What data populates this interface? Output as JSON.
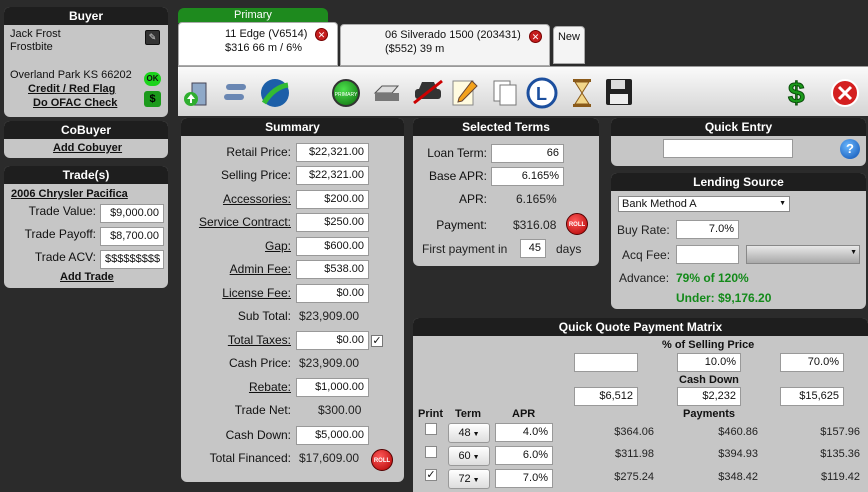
{
  "buyer": {
    "title": "Buyer",
    "name_first": "Jack Frost",
    "name_last": "Frostbite",
    "location": "Overland Park KS 66202",
    "credit_link": "Credit / Red Flag",
    "ofac_link": "Do OFAC Check",
    "ok_badge": "OK",
    "dollar_badge": "$"
  },
  "cobuyer": {
    "title": "CoBuyer",
    "add_link": "Add Cobuyer"
  },
  "trades": {
    "title": "Trade(s)",
    "vehicle": "2006 Chrysler Pacifica",
    "trade_value_label": "Trade Value:",
    "trade_value": "$9,000.00",
    "trade_payoff_label": "Trade Payoff:",
    "trade_payoff": "$8,700.00",
    "trade_acv_label": "Trade ACV:",
    "trade_acv": "$$$$$$$$$",
    "add_link": "Add Trade"
  },
  "tabs": {
    "primary_label": "Primary",
    "tab1_line1": "11 Edge  (V6514)",
    "tab1_line2": "$316 66 m / 6%",
    "tab2_line1": "06 Silverado 1500  (203431)",
    "tab2_line2": "($552) 39 m",
    "new_label": "New"
  },
  "toolbar": {
    "primary_badge": "PRIMARY"
  },
  "summary": {
    "title": "Summary",
    "retail_label": "Retail Price:",
    "retail": "$22,321.00",
    "selling_label": "Selling Price:",
    "selling": "$22,321.00",
    "accessories_label": "Accessories:",
    "accessories": "$200.00",
    "service_label": "Service Contract:",
    "service": "$250.00",
    "gap_label": "Gap:",
    "gap": "$600.00",
    "admin_label": "Admin Fee:",
    "admin": "$538.00",
    "license_label": "License Fee:",
    "license": "$0.00",
    "subtotal_label": "Sub Total:",
    "subtotal": "$23,909.00",
    "taxes_label": "Total Taxes:",
    "taxes": "$0.00",
    "cash_price_label": "Cash Price:",
    "cash_price": "$23,909.00",
    "rebate_label": "Rebate:",
    "rebate": "$1,000.00",
    "trade_net_label": "Trade Net:",
    "trade_net": "$300.00",
    "cash_down_label": "Cash Down:",
    "cash_down": "$5,000.00",
    "total_fin_label": "Total Financed:",
    "total_fin": "$17,609.00",
    "roll_label": "ROLL"
  },
  "terms": {
    "title": "Selected Terms",
    "loan_term_label": "Loan Term:",
    "loan_term": "66",
    "base_apr_label": "Base APR:",
    "base_apr": "6.165%",
    "apr_label": "APR:",
    "apr": "6.165%",
    "payment_label": "Payment:",
    "payment": "$316.08",
    "roll_label": "ROLL",
    "first_payment_label": "First payment in",
    "first_payment": "45",
    "days_label": "days"
  },
  "quick_entry": {
    "title": "Quick Entry",
    "value": ""
  },
  "lending": {
    "title": "Lending Source",
    "bank": "Bank Method A",
    "buy_rate_label": "Buy Rate:",
    "buy_rate": "7.0%",
    "acq_fee_label": "Acq Fee:",
    "acq_fee": "",
    "advance_label": "Advance:",
    "advance": "79% of 120%",
    "under": "Under: $9,176.20"
  },
  "matrix": {
    "title": "Quick Quote Payment Matrix",
    "pct_header": "% of Selling Price",
    "pct": [
      "",
      "10.0%",
      "70.0%"
    ],
    "cash_header": "Cash Down",
    "cash": [
      "$6,512",
      "$2,232",
      "$15,625"
    ],
    "print_header": "Print",
    "term_header": "Term",
    "apr_header": "APR",
    "payments_header": "Payments",
    "rows": [
      {
        "checked": "",
        "term": "48",
        "apr": "4.0%",
        "p1": "$364.06",
        "p2": "$460.86",
        "p3": "$157.96"
      },
      {
        "checked": "",
        "term": "60",
        "apr": "6.0%",
        "p1": "$311.98",
        "p2": "$394.93",
        "p3": "$135.36"
      },
      {
        "checked": "✓",
        "term": "72",
        "apr": "7.0%",
        "p1": "$275.24",
        "p2": "$348.42",
        "p3": "$119.42"
      }
    ]
  }
}
